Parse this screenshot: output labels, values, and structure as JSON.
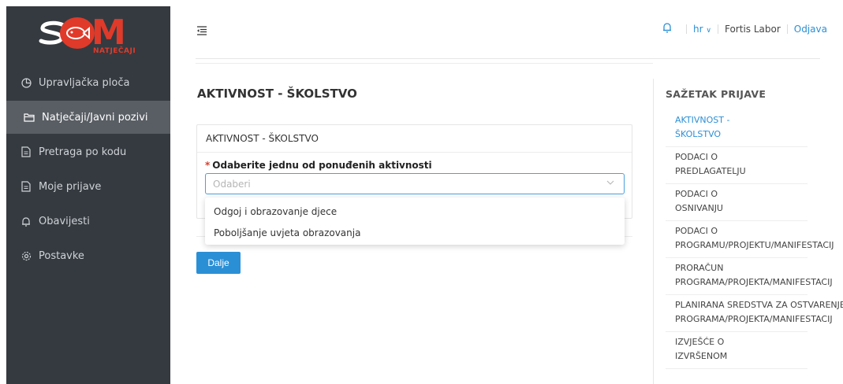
{
  "logo": {
    "main_text": "SOM",
    "sub_text": "NATJEČAJI"
  },
  "sidebar": {
    "items": [
      {
        "label": "Upravljačka ploča",
        "icon": "dashboard-icon",
        "active": false
      },
      {
        "label": "Natječaji/Javni pozivi",
        "icon": "folder-icon",
        "active": true
      },
      {
        "label": "Pretraga po kodu",
        "icon": "document-icon",
        "active": false
      },
      {
        "label": "Moje prijave",
        "icon": "document-icon",
        "active": false
      },
      {
        "label": "Obavijesti",
        "icon": "bell-icon",
        "active": false
      },
      {
        "label": "Postavke",
        "icon": "gear-icon",
        "active": false
      }
    ]
  },
  "header": {
    "lang": "hr",
    "user": "Fortis Labor",
    "logout": "Odjava"
  },
  "main": {
    "title": "AKTIVNOST - ŠKOLSTVO",
    "panel_title": "AKTIVNOST - ŠKOLSTVO",
    "field_label": "Odaberite jednu od ponuđenih aktivnosti",
    "required_mark": "*",
    "select_placeholder": "Odaberi",
    "options": [
      "Odgoj i obrazovanje djece",
      "Poboljšanje uvjeta obrazovanja"
    ],
    "next_button": "Dalje"
  },
  "summary": {
    "title": "SAŽETAK PRIJAVE",
    "items": [
      {
        "line1": "AKTIVNOST -",
        "line2": "ŠKOLSTVO"
      },
      {
        "line1": "PODACI O",
        "line2": "PREDLAGATELJU"
      },
      {
        "line1": "PODACI O",
        "line2": "OSNIVANJU"
      },
      {
        "line1": "PODACI O",
        "line2": "PROGRAMU/PROJEKTU/MANIFESTACIJ"
      },
      {
        "line1": "PRORAČUN",
        "line2": "PROGRAMA/PROJEKTA/MANIFESTACIJ"
      },
      {
        "line1": "PLANIRANA SREDSTVA ZA OSTVARENJE",
        "line2": "PROGRAMA/PROJEKTA/MANIFESTACIJ"
      },
      {
        "line1": "IZVJEŠĆE O",
        "line2": "IZVRŠENOM"
      }
    ]
  },
  "colors": {
    "accent": "#2b8fd6",
    "sidebar_bg": "#353a40",
    "sidebar_active": "#595e64",
    "brand": "#e03a2a"
  }
}
